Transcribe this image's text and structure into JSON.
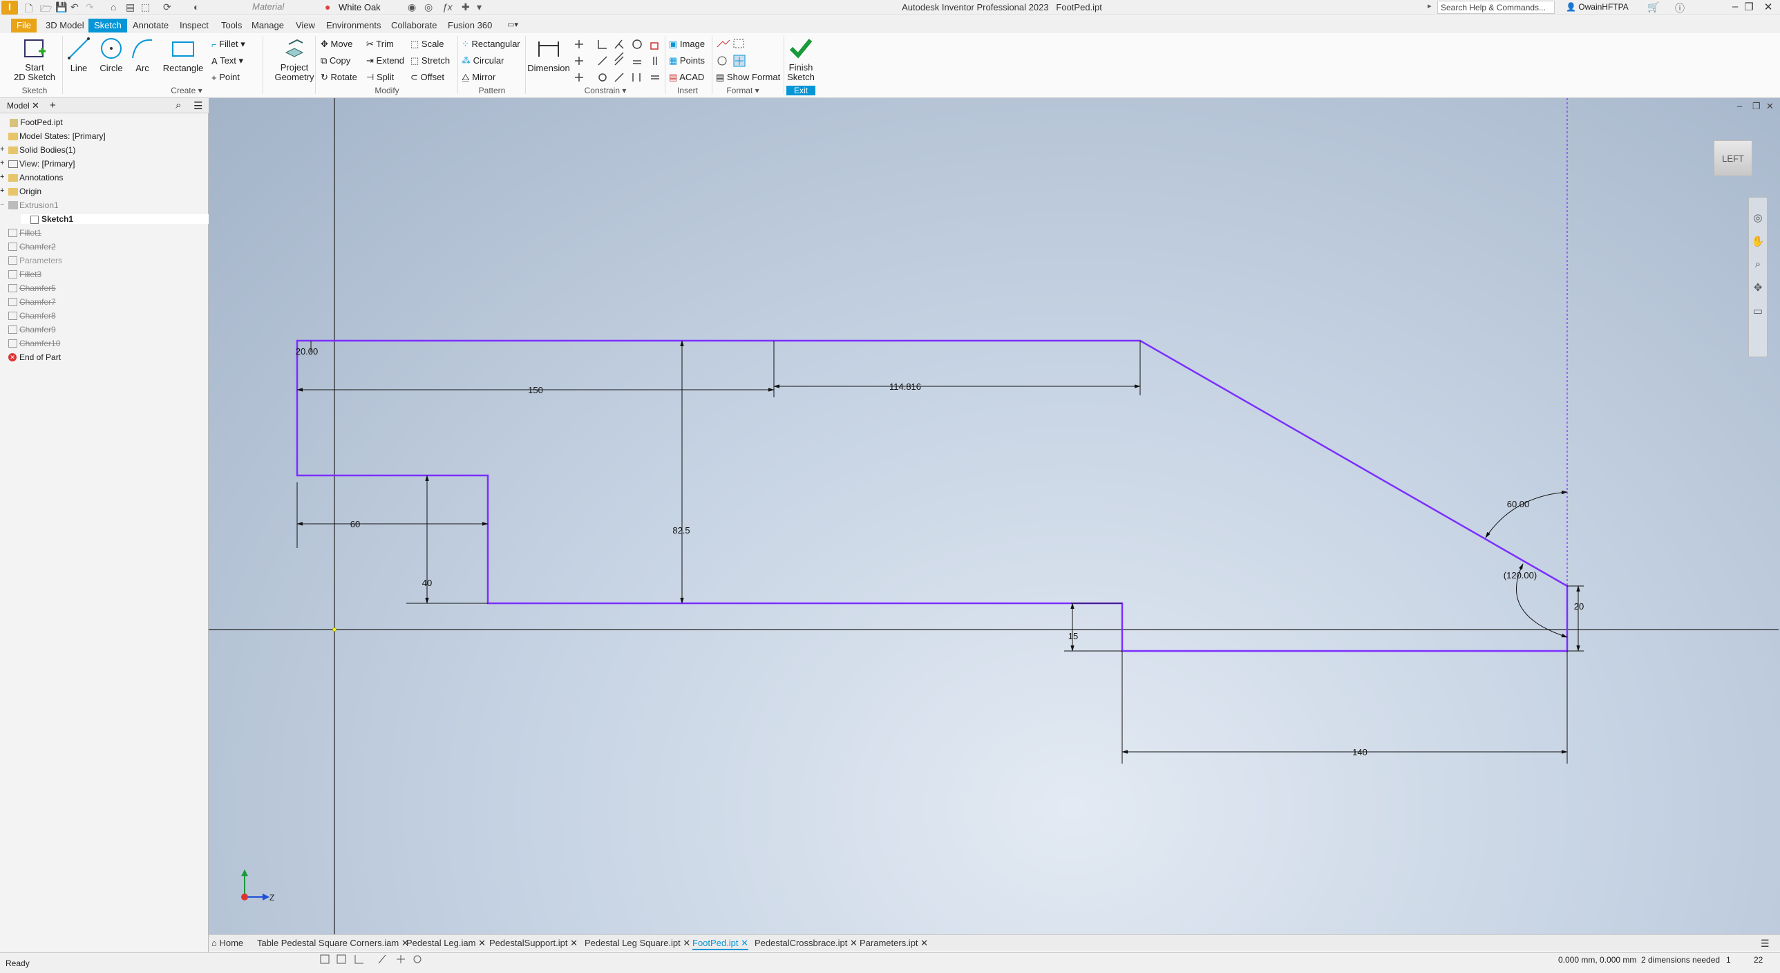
{
  "app": {
    "title": "Autodesk Inventor Professional 2023",
    "document": "FootPed.ipt",
    "search_placeholder": "Search Help & Commands...",
    "user": "OwainHFTPA",
    "material": "Material",
    "appearance": "White Oak"
  },
  "menu_tabs": [
    "File",
    "3D Model",
    "Sketch",
    "Annotate",
    "Inspect",
    "Tools",
    "Manage",
    "View",
    "Environments",
    "Collaborate",
    "Fusion 360"
  ],
  "ribbon": {
    "start_sketch": "Start\n2D Sketch",
    "line": "Line",
    "circle": "Circle",
    "arc": "Arc",
    "rectangle": "Rectangle",
    "fillet": "Fillet",
    "text": "Text",
    "point": "Point",
    "project_geometry": "Project\nGeometry",
    "move": "Move",
    "copy": "Copy",
    "rotate": "Rotate",
    "trim": "Trim",
    "extend": "Extend",
    "split": "Split",
    "scale": "Scale",
    "stretch": "Stretch",
    "offset": "Offset",
    "rectangular": "Rectangular",
    "circular": "Circular",
    "mirror": "Mirror",
    "dimension": "Dimension",
    "image": "Image",
    "points": "Points",
    "acad": "ACAD",
    "show_format": "Show Format",
    "finish_sketch": "Finish\nSketch",
    "groups": {
      "sketch": "Sketch",
      "create": "Create",
      "modify": "Modify",
      "pattern": "Pattern",
      "constrain": "Constrain",
      "insert": "Insert",
      "format": "Format",
      "exit": "Exit"
    }
  },
  "browser": {
    "tab": "Model",
    "nodes": [
      {
        "label": "FootPed.ipt",
        "state": "normal"
      },
      {
        "label": "Model States: [Primary]",
        "state": "normal"
      },
      {
        "label": "Solid Bodies(1)",
        "state": "normal"
      },
      {
        "label": "View: [Primary]",
        "state": "normal"
      },
      {
        "label": "Annotations",
        "state": "normal"
      },
      {
        "label": "Origin",
        "state": "normal"
      },
      {
        "label": "Extrusion1",
        "state": "grey"
      },
      {
        "label": "Sketch1",
        "state": "selected"
      },
      {
        "label": "Fillet1",
        "state": "suppressed"
      },
      {
        "label": "Chamfer2",
        "state": "suppressed"
      },
      {
        "label": "Parameters",
        "state": "grey"
      },
      {
        "label": "Fillet3",
        "state": "suppressed"
      },
      {
        "label": "Chamfer5",
        "state": "suppressed"
      },
      {
        "label": "Chamfer7",
        "state": "suppressed"
      },
      {
        "label": "Chamfer8",
        "state": "suppressed"
      },
      {
        "label": "Chamfer9",
        "state": "suppressed"
      },
      {
        "label": "Chamfer10",
        "state": "suppressed"
      },
      {
        "label": "End of Part",
        "state": "error"
      }
    ]
  },
  "viewcube": "LEFT",
  "dimensions": {
    "d20a": "20.00",
    "d150": "150",
    "d114": "114.816",
    "d825": "82.5",
    "d60": "60",
    "d40": "40",
    "d15": "15",
    "d140": "140",
    "a60": "60.00",
    "a120": "(120.00)",
    "d20b": "20"
  },
  "axis": {
    "z": "Z"
  },
  "doc_tabs": [
    "Home",
    "Table Pedestal Square Corners.iam",
    "Pedestal Leg.iam",
    "PedestalSupport.ipt",
    "Pedestal Leg Square.ipt",
    "FootPed.ipt",
    "PedestalCrossbrace.ipt",
    "Parameters.ipt"
  ],
  "status": {
    "text": "Ready",
    "coords": "0.000 mm, 0.000 mm",
    "dims_needed": "2 dimensions needed",
    "count": "1",
    "zoom": "22"
  },
  "colors": {
    "accent": "#0696d7",
    "file_tab": "#e8a317",
    "sketch_line": "#7b2fff"
  }
}
